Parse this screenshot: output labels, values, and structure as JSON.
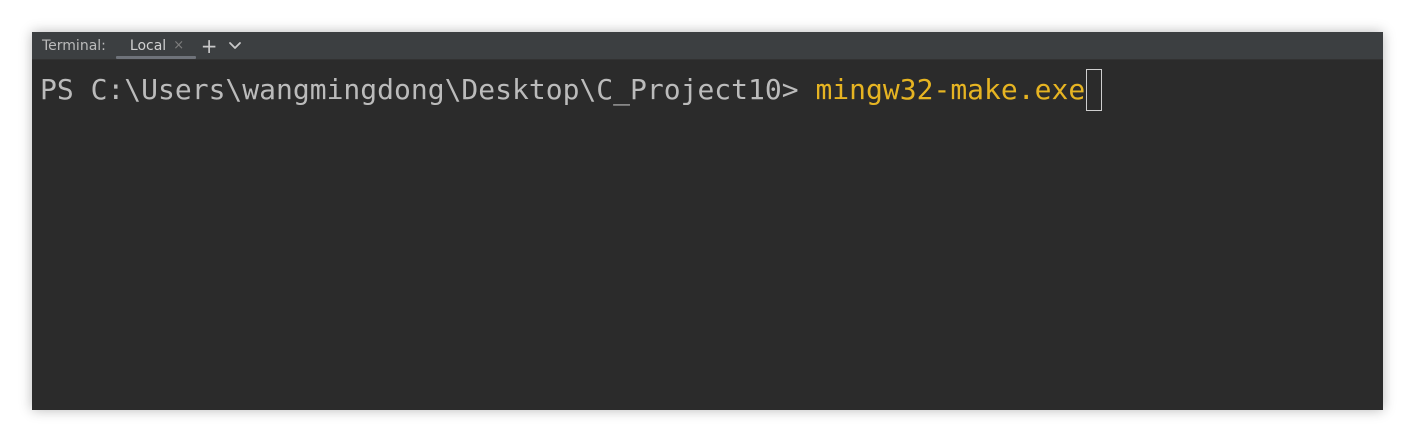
{
  "tool_window": {
    "title": "Terminal:"
  },
  "tabs": [
    {
      "label": "Local",
      "active": true,
      "close_glyph": "×"
    }
  ],
  "toolbar": {
    "add_glyph": "+",
    "add_icon": "plus-icon",
    "dropdown_icon": "chevron-down-icon"
  },
  "terminal": {
    "prompt": "PS C:\\Users\\wangmingdong\\Desktop\\C_Project10> ",
    "command": "mingw32-make.exe"
  },
  "colors": {
    "background": "#2b2b2b",
    "tabbar": "#3c3f41",
    "prompt_text": "#bbbbbb",
    "command_text": "#e6b422",
    "cursor_outline": "#cfcfcf"
  }
}
